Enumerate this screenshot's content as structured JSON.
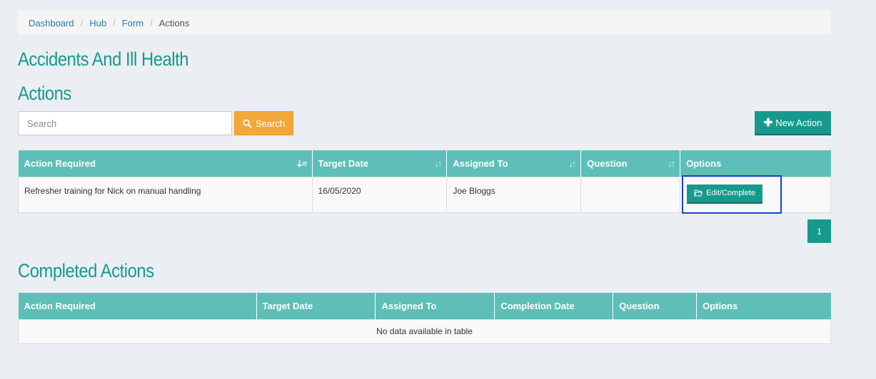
{
  "breadcrumb": {
    "items": [
      "Dashboard",
      "Hub",
      "Form"
    ],
    "separator": "/",
    "current": "Actions"
  },
  "headings": {
    "module": "Accidents And Ill Health",
    "actions": "Actions",
    "completed": "Completed Actions"
  },
  "search": {
    "placeholder": "Search",
    "value": "",
    "button_label": "Search",
    "icon": "search-icon"
  },
  "new_action": {
    "label": "New Action",
    "icon": "plus-icon"
  },
  "actions_table": {
    "columns": [
      "Action Required",
      "Target Date",
      "Assigned To",
      "Question",
      "Options"
    ],
    "rows": [
      {
        "action_required": "Refresher training for Nick on manual handling",
        "target_date": "16/05/2020",
        "assigned_to": "Joe Bloggs",
        "question": "",
        "option_label": "Edit/Complete",
        "option_icon": "folder-open-icon"
      }
    ]
  },
  "pagination": {
    "pages": [
      "1"
    ],
    "current": "1"
  },
  "completed_table": {
    "columns": [
      "Action Required",
      "Target Date",
      "Assigned To",
      "Completion Date",
      "Question",
      "Options"
    ],
    "empty_message": "No data available in table"
  },
  "colors": {
    "teal": "#17998d",
    "header_teal": "#5dbfb8",
    "search_orange": "#f4a73a",
    "link_blue": "#2a7bb5",
    "highlight_blue": "#1a3fd6"
  }
}
